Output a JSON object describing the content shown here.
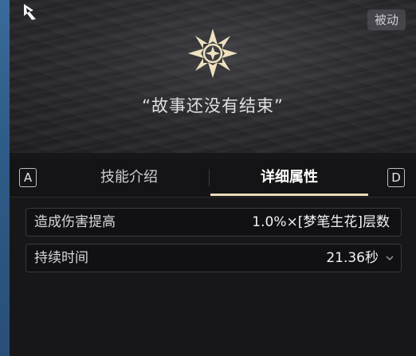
{
  "header": {
    "passive_tag": "被动",
    "quote": "“故事还没有结束”"
  },
  "tabs": {
    "left_key": "A",
    "right_key": "D",
    "items": [
      {
        "label": "技能介绍",
        "active": false
      },
      {
        "label": "详细属性",
        "active": true
      }
    ]
  },
  "details": [
    {
      "label": "造成伤害提高",
      "value": "1.0%×[梦笔生花]层数"
    },
    {
      "label": "持续时间",
      "value": "21.36秒"
    }
  ],
  "colors": {
    "accent": "#e8dcb8",
    "emblem": "#efe2c0",
    "edge": "#2e5c88"
  }
}
